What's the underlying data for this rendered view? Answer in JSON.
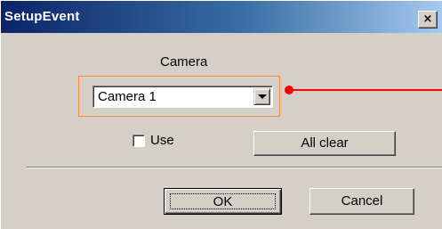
{
  "window": {
    "title": "SetupEvent",
    "close_glyph": "×"
  },
  "camera_section": {
    "label": "Camera",
    "selected_value": "Camera 1"
  },
  "use_checkbox": {
    "label": "Use",
    "checked": false
  },
  "buttons": {
    "all_clear": "All clear",
    "ok": "OK",
    "cancel": "Cancel"
  },
  "colors": {
    "titlebar_start": "#0a246a",
    "titlebar_end": "#a6caf0",
    "dialog_face": "#d4d0c8",
    "highlight_border": "#ff8a3d",
    "callout": "#ff0000"
  },
  "icons": {
    "close": "close-icon",
    "dropdown": "chevron-down-icon"
  }
}
